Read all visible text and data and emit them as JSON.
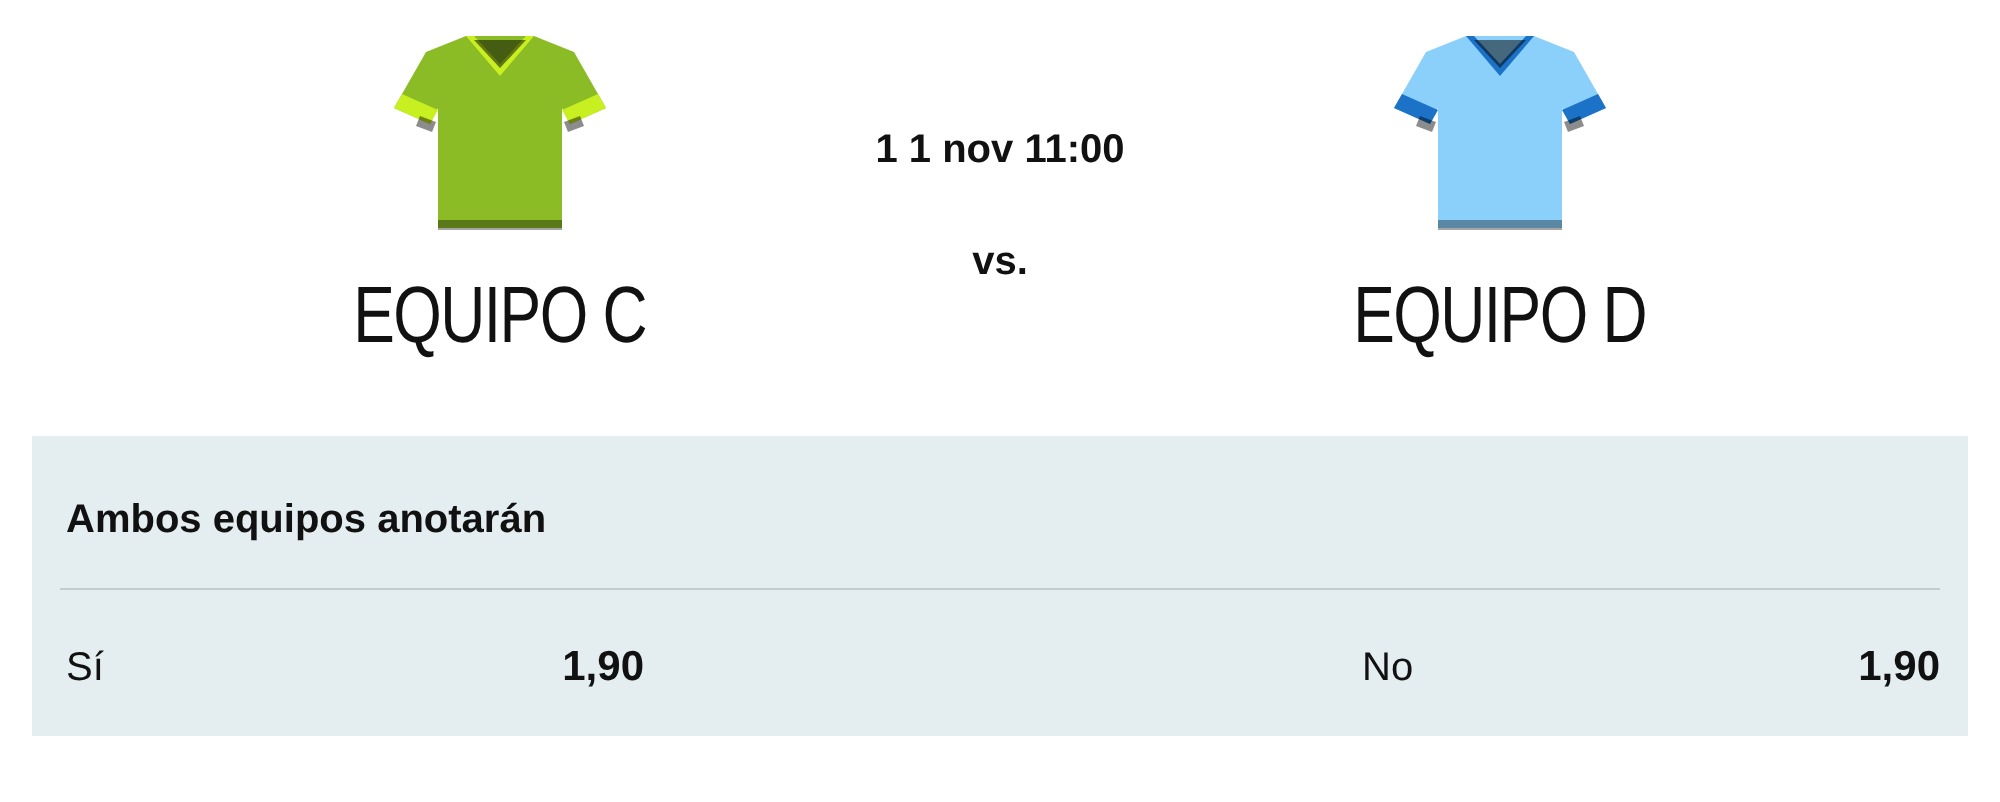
{
  "match": {
    "date": "1 1 nov 11:00",
    "versus": "vs."
  },
  "teams": [
    {
      "name": "EQUIPO C",
      "jersey": [
        {
          "kind": "body",
          "color": "#8bbb25"
        },
        {
          "kind": "trim",
          "color": "#c8f020"
        }
      ]
    },
    {
      "name": "EQUIPO D",
      "jersey": [
        {
          "kind": "body",
          "color": "#8ad0fb"
        },
        {
          "kind": "trim",
          "color": "#1b72c6"
        }
      ]
    }
  ],
  "market": {
    "title": "Ambos equipos anotarán",
    "options": [
      {
        "label": "Sí",
        "odds": "1,90"
      },
      {
        "label": "No",
        "odds": "1,90"
      }
    ]
  }
}
